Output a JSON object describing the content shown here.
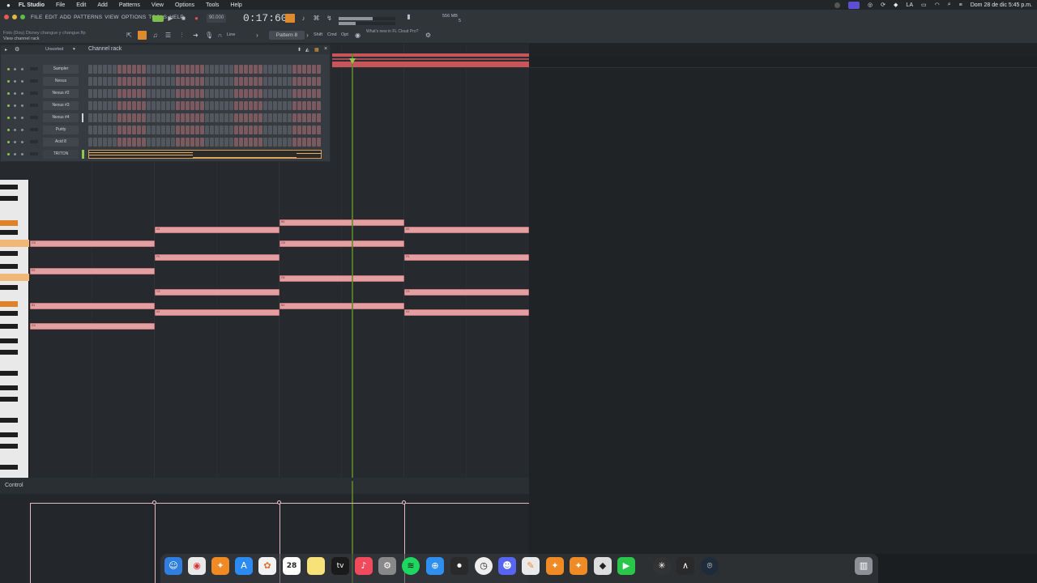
{
  "menubar": {
    "app": "FL Studio",
    "items": [
      "File",
      "Edit",
      "Add",
      "Patterns",
      "View",
      "Options",
      "Tools",
      "Help"
    ],
    "lang": "LA",
    "datetime": "Dom 28 de dic  5:45 p.m."
  },
  "toolbar": {
    "fl_menu": "FILE  EDIT  ADD  PATTERNS  VIEW  OPTIONS  TOOLS  HELP",
    "project_file": "Foto (Dou) Disney changue y changue.flp",
    "hint": "View channel rack",
    "tempo": "90.000",
    "time": "0:17:60",
    "line_label": "Line",
    "pattern": "Pattern 8",
    "shift": "Shift",
    "cmd": "Cmd",
    "opt": "Opt",
    "news": "What's new in FL Cloud Pro?",
    "mem": "556 MB",
    "cpu": "5"
  },
  "channel_rack": {
    "title": "Channel rack",
    "filter": "Unsorted",
    "channels": [
      {
        "name": "Sampler"
      },
      {
        "name": "Nexus"
      },
      {
        "name": "Nexus #2"
      },
      {
        "name": "Nexus #3"
      },
      {
        "name": "Nexus #4"
      },
      {
        "name": "Purity"
      },
      {
        "name": "Acid 8"
      },
      {
        "name": "TRITON"
      }
    ]
  },
  "control": {
    "label": "Control"
  },
  "colors": {
    "note": "#e2a0a2",
    "accent_orange": "#e08a2e",
    "playhead": "#5f8a2a"
  },
  "dock": {
    "calendar_day": "28",
    "appletv": "tv",
    "apps": [
      "finder-icon",
      "chrome-icon",
      "fl-studio-icon",
      "app-store-icon",
      "photos-icon",
      "calendar-icon",
      "notes-icon",
      "apple-tv-icon",
      "music-icon",
      "settings-icon",
      "spotify-icon",
      "safari-icon",
      "audio-app-icon",
      "clock-icon",
      "discord-icon",
      "pages-icon",
      "fl-studio-icon-2",
      "fl-studio-icon-3",
      "roblox-icon",
      "facetime-icon",
      "antares-icon",
      "app-icon",
      "vpn-icon",
      "trash-icon"
    ]
  }
}
